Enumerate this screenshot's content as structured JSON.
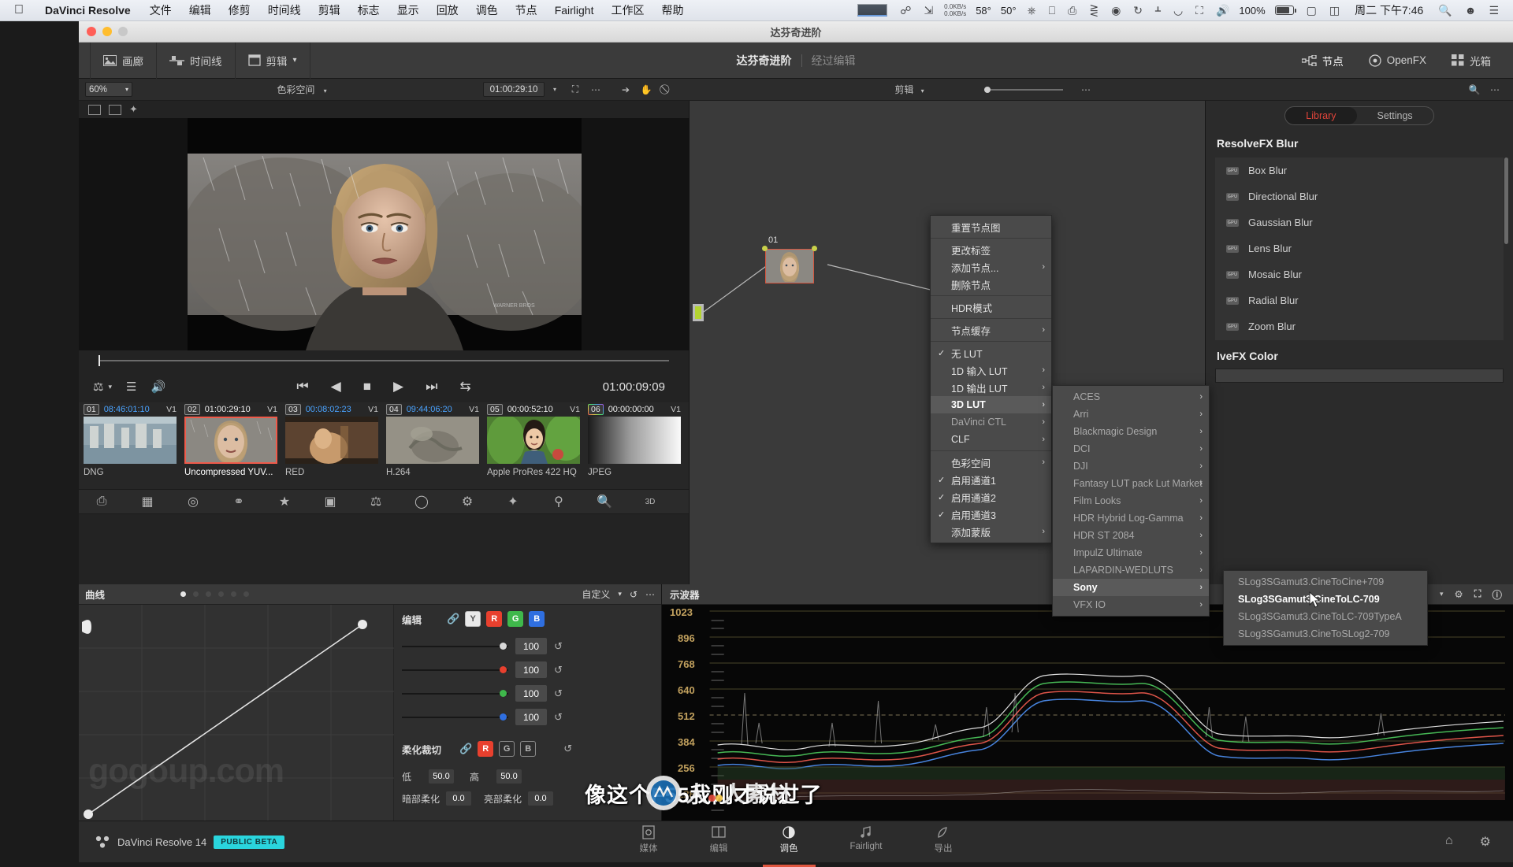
{
  "macbar": {
    "apple_icon": "apple-icon",
    "app_name": "DaVinci Resolve",
    "menus": [
      "文件",
      "编辑",
      "修剪",
      "时间线",
      "剪辑",
      "标志",
      "显示",
      "回放",
      "调色",
      "节点",
      "Fairlight",
      "工作区",
      "帮助"
    ],
    "net_up": "0.0KB/s",
    "net_down": "0.0KB/s",
    "temp_cpu": "58°",
    "temp_gpu": "50°",
    "battery_percent": "100%",
    "clock": "周二 下午7:46",
    "status_icons": [
      "display-icon",
      "mouse-icon",
      "lightning-icon",
      "record-icon",
      "timemachine-icon",
      "bluetooth-icon",
      "wifi-icon",
      "airplay-icon",
      "volume-icon",
      "battery-icon",
      "keyboard-input-icon",
      "search-icon",
      "user-icon",
      "list-icon"
    ]
  },
  "window": {
    "title": "达芬奇进阶",
    "traffic_lights": [
      "close",
      "minimize",
      "zoom"
    ]
  },
  "app_toolbar": {
    "left_buttons": [
      {
        "label": "画廊",
        "icon": "gallery-icon"
      },
      {
        "label": "时间线",
        "icon": "timeline-icon"
      },
      {
        "label": "剪辑",
        "icon": "clip-icon",
        "caret": "▾"
      }
    ],
    "project_title": "达芬奇进阶",
    "project_sub": "经过编辑",
    "right_buttons": [
      {
        "label": "节点",
        "icon": "nodes-icon"
      },
      {
        "label": "OpenFX",
        "icon": "openfx-icon"
      },
      {
        "label": "光箱",
        "icon": "lightbox-icon"
      }
    ]
  },
  "bar2": {
    "zoom_value": "60%",
    "colorspace_label": "色彩空间",
    "timecode": "01:00:29:10",
    "node_mode": "剪辑",
    "tool_icons": [
      "fit-icon",
      "more-icon",
      "pointer-icon",
      "hand-icon",
      "lasso-icon",
      "search-icon",
      "more-icon"
    ]
  },
  "viewer": {
    "tool_icons": [
      "split-screen-icon",
      "wipe-icon",
      "magic-icon"
    ],
    "transport": {
      "icons": [
        "color-picker-icon",
        "layers-icon",
        "speaker-icon",
        "jump-start-icon",
        "step-back-icon",
        "stop-icon",
        "play-icon",
        "jump-end-icon",
        "loop-icon"
      ],
      "timecode": "01:00:09:09"
    },
    "scrub_position_percent": 0
  },
  "clips": [
    {
      "no": "01",
      "tc": "08:46:01:10",
      "tc_color": "blue",
      "track": "V1",
      "name": "DNG",
      "selected": false
    },
    {
      "no": "02",
      "tc": "01:00:29:10",
      "tc_color": "white",
      "track": "V1",
      "name": "Uncompressed YUV...",
      "selected": true
    },
    {
      "no": "03",
      "tc": "00:08:02:23",
      "tc_color": "blue",
      "track": "V1",
      "name": "RED",
      "selected": false
    },
    {
      "no": "04",
      "tc": "09:44:06:20",
      "tc_color": "blue",
      "track": "V1",
      "name": "H.264",
      "selected": false
    },
    {
      "no": "05",
      "tc": "00:00:52:10",
      "tc_color": "white",
      "track": "V1",
      "name": "Apple ProRes 422 HQ",
      "selected": false
    },
    {
      "no": "06",
      "tc": "00:00:00:00",
      "tc_color": "white",
      "track": "V1",
      "name": "JPEG",
      "selected": false,
      "rainbow": true
    }
  ],
  "icon_row": [
    "print-icon",
    "gallery-grid-icon",
    "circle-icon",
    "tracker-icon",
    "star-icon",
    "window-icon",
    "picker-icon",
    "ellipse-icon",
    "gear-icon",
    "magic-wand-icon",
    "key-icon",
    "blur-icon",
    "3d-icon"
  ],
  "node_graph": {
    "node_label": "01",
    "input_terminal": "input",
    "output_terminal": "output"
  },
  "library_panel": {
    "tabs": [
      {
        "label": "Library",
        "active": true
      },
      {
        "label": "Settings",
        "active": false
      }
    ],
    "group_title": "ResolveFX Blur",
    "items": [
      {
        "label": "Box Blur",
        "badge": "GPU"
      },
      {
        "label": "Directional Blur",
        "badge": "GPU"
      },
      {
        "label": "Gaussian Blur",
        "badge": "GPU"
      },
      {
        "label": "Lens Blur",
        "badge": "GPU"
      },
      {
        "label": "Mosaic Blur",
        "badge": "GPU"
      },
      {
        "label": "Radial Blur",
        "badge": "GPU"
      },
      {
        "label": "Zoom Blur",
        "badge": "GPU"
      }
    ],
    "group_title2": "lveFX Color"
  },
  "context_menu_node": {
    "items": [
      {
        "label": "重置节点图",
        "type": "item"
      },
      {
        "type": "sep"
      },
      {
        "label": "更改标签",
        "type": "item"
      },
      {
        "label": "添加节点...",
        "type": "item",
        "arrow": true
      },
      {
        "label": "删除节点",
        "type": "item"
      },
      {
        "type": "sep"
      },
      {
        "label": "HDR模式",
        "type": "item"
      },
      {
        "type": "sep"
      },
      {
        "label": "节点缓存",
        "type": "item",
        "arrow": true
      },
      {
        "type": "sep"
      },
      {
        "label": "无 LUT",
        "type": "item",
        "checked": true
      },
      {
        "label": "1D 输入 LUT",
        "type": "item",
        "arrow": true
      },
      {
        "label": "1D 输出 LUT",
        "type": "item",
        "arrow": true
      },
      {
        "label": "3D LUT",
        "type": "item",
        "arrow": true,
        "bold": true,
        "highlight": true
      },
      {
        "label": "DaVinci CTL",
        "type": "item",
        "arrow": true,
        "dim": true
      },
      {
        "label": "CLF",
        "type": "item",
        "arrow": true
      },
      {
        "type": "sep"
      },
      {
        "label": "色彩空间",
        "type": "item",
        "arrow": true
      },
      {
        "label": "启用通道1",
        "type": "item",
        "checked": true
      },
      {
        "label": "启用通道2",
        "type": "item",
        "checked": true
      },
      {
        "label": "启用通道3",
        "type": "item",
        "checked": true
      },
      {
        "label": "添加蒙版",
        "type": "item",
        "arrow": true
      }
    ]
  },
  "context_menu_lut_vendors": {
    "items": [
      {
        "label": "ACES",
        "arrow": true
      },
      {
        "label": "Arri",
        "arrow": true
      },
      {
        "label": "Blackmagic Design",
        "arrow": true
      },
      {
        "label": "DCI",
        "arrow": true
      },
      {
        "label": "DJI",
        "arrow": true
      },
      {
        "label": "Fantasy LUT pack Lut Market",
        "arrow": true
      },
      {
        "label": "Film Looks",
        "arrow": true
      },
      {
        "label": "HDR Hybrid Log-Gamma",
        "arrow": true
      },
      {
        "label": "HDR ST 2084",
        "arrow": true
      },
      {
        "label": "ImpulZ Ultimate",
        "arrow": true
      },
      {
        "label": "LAPARDIN-WEDLUTS",
        "arrow": true
      },
      {
        "label": "Sony",
        "arrow": true,
        "bold": true,
        "highlight": true
      },
      {
        "label": "VFX IO",
        "arrow": true
      }
    ]
  },
  "context_menu_sony_luts": {
    "items": [
      {
        "label": "SLog3SGamut3.CineToCine+709",
        "dim": true
      },
      {
        "label": "SLog3SGamut3.CineToLC-709",
        "bold": true
      },
      {
        "label": "SLog3SGamut3.CineToLC-709TypeA",
        "dim": true
      },
      {
        "label": "SLog3SGamut3.CineToSLog2-709",
        "dim": true
      }
    ]
  },
  "curves_panel": {
    "title": "曲线",
    "mode": "自定义",
    "mode_caret": "▾",
    "reset_icon": "reset-icon",
    "more_icon": "more-icon",
    "edit_label": "编辑",
    "link_icon": "link-icon",
    "channels": [
      "Y",
      "R",
      "G",
      "B"
    ],
    "sliders": [
      {
        "channel": "Y",
        "value": "100",
        "color": "#d8d8d8",
        "pos": 92
      },
      {
        "channel": "R",
        "value": "100",
        "color": "#e8402e",
        "pos": 92
      },
      {
        "channel": "G",
        "value": "100",
        "color": "#3fb84b",
        "pos": 92
      },
      {
        "channel": "B",
        "value": "100",
        "color": "#2f6fe0",
        "pos": 92
      }
    ],
    "soft_clip_label": "柔化裁切",
    "soft_clip_channels": [
      "R",
      "G",
      "B"
    ],
    "low_label": "低",
    "low_value": "50.0",
    "high_label": "高",
    "high_value": "50.0",
    "low_soft_label": "暗部柔化",
    "low_soft_value": "0.0",
    "high_soft_label": "亮部柔化",
    "high_soft_value": "0.0",
    "watermark": "gogoup.com"
  },
  "scope_panel": {
    "title": "示波器",
    "y_ticks": [
      "1023",
      "896",
      "768",
      "640",
      "512",
      "384",
      "256",
      "128"
    ],
    "icons": [
      "picker-icon",
      "waveform-icon",
      "grid-icon",
      "settings-icon",
      "info-icon",
      "fullscreen-icon"
    ]
  },
  "statusbar": {
    "product": "DaVinci Resolve 14",
    "beta_tag": "PUBLIC BETA",
    "pages": [
      {
        "label": "媒体",
        "icon": "media-icon",
        "active": false
      },
      {
        "label": "编辑",
        "icon": "edit-icon",
        "active": false
      },
      {
        "label": "调色",
        "icon": "color-icon",
        "active": true
      },
      {
        "label": "Fairlight",
        "icon": "audio-icon",
        "active": false
      },
      {
        "label": "导出",
        "icon": "deliver-icon",
        "active": false
      }
    ],
    "right_icons": [
      "home-icon",
      "settings-icon"
    ]
  },
  "subtitle": "像这个F55我刚才说过了",
  "watermark": {
    "text": "人 人 素材"
  },
  "colors": {
    "accent_red": "#e0443a",
    "node_green": "#b4d430",
    "selection_orange": "#ef5a4a",
    "beta_cyan": "#2ad5dd"
  }
}
